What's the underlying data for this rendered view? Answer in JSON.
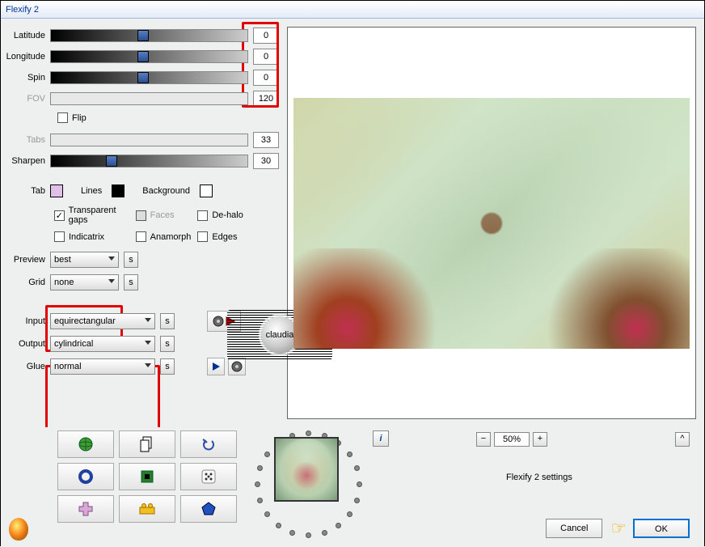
{
  "window_title": "Flexify 2",
  "sliders": {
    "latitude": {
      "label": "Latitude",
      "value": "0",
      "thumb_pct": 44,
      "disabled": false
    },
    "longitude": {
      "label": "Longitude",
      "value": "0",
      "thumb_pct": 44,
      "disabled": false
    },
    "spin": {
      "label": "Spin",
      "value": "0",
      "thumb_pct": 44,
      "disabled": false
    },
    "fov": {
      "label": "FOV",
      "value": "120",
      "thumb_pct": 100,
      "disabled": true
    },
    "tabs_sl": {
      "label": "Tabs",
      "value": "33",
      "thumb_pct": 0,
      "disabled": true
    },
    "sharpen": {
      "label": "Sharpen",
      "value": "30",
      "thumb_pct": 28,
      "disabled": false
    }
  },
  "flip_label": "Flip",
  "colors": {
    "tab": {
      "label": "Tab",
      "color": "#e0c0e8"
    },
    "lines": {
      "label": "Lines",
      "color": "#000000"
    },
    "background": {
      "label": "Background",
      "color": "#ffffff"
    }
  },
  "checkboxes": {
    "transparent_gaps": {
      "label": "Transparent gaps",
      "checked": true
    },
    "faces": {
      "label": "Faces",
      "checked": false,
      "disabled": true
    },
    "dehalo": {
      "label": "De-halo",
      "checked": false
    },
    "indicatrix": {
      "label": "Indicatrix",
      "checked": false
    },
    "anamorph": {
      "label": "Anamorph",
      "checked": false
    },
    "edges": {
      "label": "Edges",
      "checked": false
    }
  },
  "preview_dd": {
    "label": "Preview",
    "value": "best"
  },
  "grid_dd": {
    "label": "Grid",
    "value": "none"
  },
  "input_dd": {
    "label": "Input",
    "value": "equirectangular"
  },
  "output_dd": {
    "label": "Output",
    "value": "cylindrical"
  },
  "glue_dd": {
    "label": "Glue",
    "value": "normal"
  },
  "s_btn": "s",
  "zoom_pct": "50%",
  "settings_label": "Flexify 2 settings",
  "ok_label": "OK",
  "cancel_label": "Cancel",
  "watermark_text": "claudia"
}
